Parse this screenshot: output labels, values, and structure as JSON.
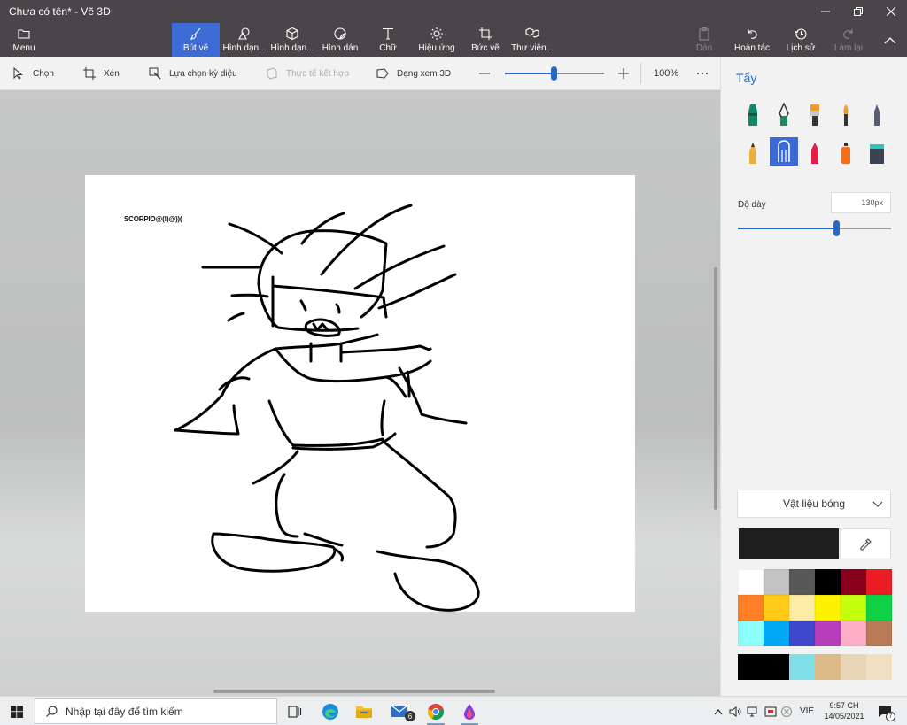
{
  "window": {
    "title": "Chưa có tên* - Vẽ 3D",
    "controls": [
      "minimize",
      "restore",
      "close"
    ]
  },
  "ribbon": {
    "menu": "Menu",
    "tools": [
      {
        "label": "Bút vẽ",
        "icon": "brush-icon",
        "active": true
      },
      {
        "label": "Hình dạn...",
        "icon": "2d-shapes-icon"
      },
      {
        "label": "Hình dạn...",
        "icon": "3d-shapes-icon"
      },
      {
        "label": "Hình dán",
        "icon": "stickers-icon"
      },
      {
        "label": "Chữ",
        "icon": "text-icon"
      },
      {
        "label": "Hiệu ứng",
        "icon": "effects-icon"
      },
      {
        "label": "Bức vẽ",
        "icon": "canvas-icon"
      },
      {
        "label": "Thư viện...",
        "icon": "3d-library-icon"
      }
    ],
    "actions": {
      "paste": "Dán",
      "undo": "Hoàn tác",
      "history": "Lịch sử",
      "redo": "Làm lại"
    }
  },
  "toolbar": {
    "select": "Chọn",
    "crop": "Xén",
    "magic_select": "Lựa chọn kỳ diệu",
    "mixed_reality": "Thực tế kết hợp",
    "view_3d": "Dạng xem 3D",
    "zoom_label": "100%",
    "zoom_fraction": 0.49
  },
  "canvas": {
    "signature": "SCORPIO@(!)@))("
  },
  "side_panel": {
    "title": "Tẩy",
    "brushes": [
      "marker-icon",
      "calligraphy-pen-icon",
      "oil-brush-icon",
      "watercolor-icon",
      "pixel-pen-icon",
      "pencil-icon",
      "eraser-icon",
      "crayon-icon",
      "spray-can-icon",
      "fill-bucket-icon"
    ],
    "active_brush": "eraser-icon",
    "thickness_label": "Độ dày",
    "thickness_value": "130px",
    "thickness_fraction": 0.64,
    "material": "Vật liệu bóng",
    "current_color": "#1e1e1e",
    "palette": [
      "#ffffff",
      "#c3c3c3",
      "#585858",
      "#000000",
      "#88001b",
      "#ec1c24",
      "#ff7f27",
      "#ffca18",
      "#fdeca6",
      "#fff200",
      "#c4ff0e",
      "#0ed145",
      "#8cfffb",
      "#00a8f3",
      "#3f48cc",
      "#b83dba",
      "#ffaec8",
      "#b97a56"
    ],
    "custom_colors": [
      "#000000",
      "#000000",
      "#80dee8",
      "#ddbb88",
      "#e8d5b5",
      "#f0dfc0"
    ]
  },
  "taskbar": {
    "search_placeholder": "Nhập tại đây để tìm kiếm",
    "apps": [
      "task-view-icon",
      "edge-icon",
      "file-explorer-icon",
      "mail-icon",
      "chrome-icon",
      "paint-3d-icon"
    ],
    "mail_badge": "6",
    "language": "VIE",
    "time": "9:57 CH",
    "date": "14/05/2021",
    "notification_count": "7"
  }
}
